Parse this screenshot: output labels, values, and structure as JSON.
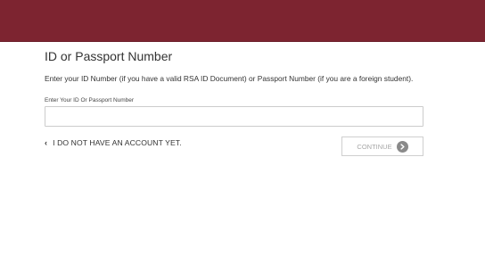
{
  "header": {
    "brand_color": "#7d2430"
  },
  "form": {
    "title": "ID or Passport Number",
    "instructions": "Enter your ID Number (if you have a valid RSA ID Document) or Passport Number (if you are a foreign student).",
    "id_field": {
      "label": "Enter Your ID Or Passport Number",
      "value": "",
      "placeholder": ""
    }
  },
  "actions": {
    "no_account_link": "I DO NOT HAVE AN ACCOUNT YET.",
    "back_icon": "chevron-left-icon",
    "continue_label": "CONTINUE",
    "continue_icon": "arrow-right-circle-icon"
  }
}
